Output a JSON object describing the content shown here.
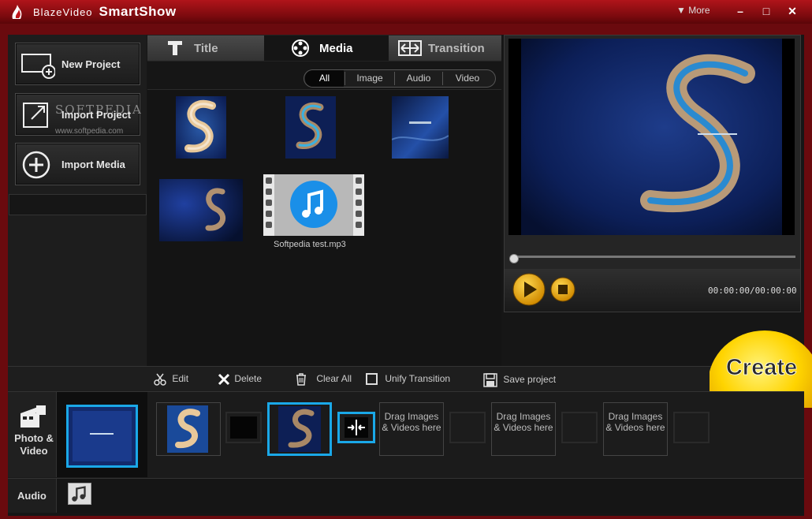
{
  "app": {
    "brand_prefix": "BlazeVideo",
    "brand_name": "SmartShow",
    "more_label": "More"
  },
  "window_controls": {
    "minimize": "–",
    "maximize": "□",
    "close": "✕"
  },
  "left_actions": [
    {
      "label": "New Project",
      "icon": "new-project-icon"
    },
    {
      "label": "Import Project",
      "icon": "import-project-icon"
    },
    {
      "label": "Import Media",
      "icon": "plus-circle-icon"
    }
  ],
  "watermark": {
    "text": "SOFTPEDIA",
    "url": "www.softpedia.com"
  },
  "tabs": [
    {
      "label": "Title",
      "icon": "title-icon"
    },
    {
      "label": "Media",
      "icon": "film-reel-icon",
      "active": true
    },
    {
      "label": "Transition",
      "icon": "transition-icon"
    }
  ],
  "filters": [
    "All",
    "Image",
    "Audio",
    "Video"
  ],
  "media_items": [
    {
      "type": "image"
    },
    {
      "type": "image"
    },
    {
      "type": "image"
    },
    {
      "type": "image"
    },
    {
      "type": "audio",
      "label": "Softpedia test.mp3"
    }
  ],
  "preview": {
    "time": "00:00:00/00:00:00",
    "progress": 0
  },
  "toolbar": {
    "edit": "Edit",
    "delete": "Delete",
    "clear_all": "Clear All",
    "unify_transition": "Unify Transition",
    "save_project": "Save project"
  },
  "create_label": "Create",
  "timeline": {
    "photo_video_label": "Photo & Video",
    "audio_label": "Audio",
    "drag_text": "Drag Images & Videos here"
  },
  "colors": {
    "titlebar": "#9a1016",
    "accent_blue": "#1aa8e8",
    "create_yellow": "#f5c800"
  }
}
